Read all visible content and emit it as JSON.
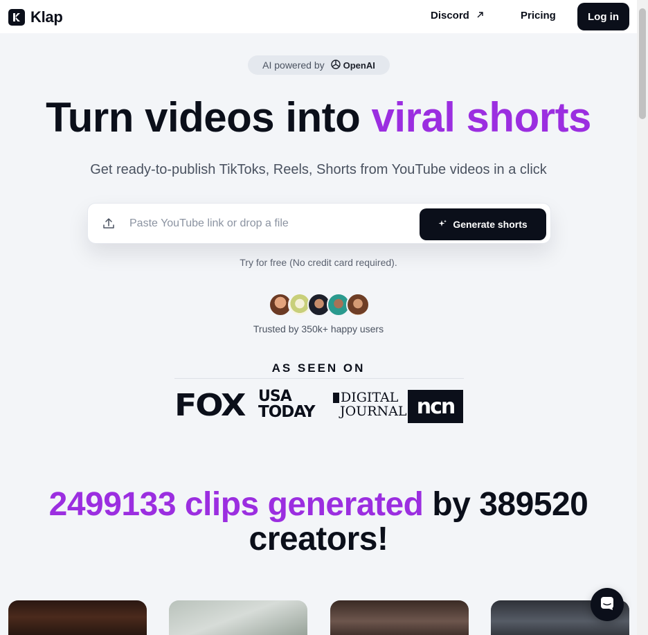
{
  "header": {
    "brand": "Klap",
    "nav": {
      "discord": "Discord",
      "pricing": "Pricing",
      "login": "Log in"
    }
  },
  "badge": {
    "prefix": "AI powered by",
    "partner": "OpenAI"
  },
  "hero": {
    "title_plain": "Turn videos into",
    "title_accent": "viral shorts",
    "subtitle": "Get ready-to-publish TikToks, Reels, Shorts from YouTube videos in a click"
  },
  "input": {
    "placeholder": "Paste YouTube link or drop a file",
    "value": "",
    "button": "Generate shorts",
    "note": "Try for free (No credit card required)."
  },
  "social_proof": {
    "avatars": [
      "avatar-1",
      "avatar-2",
      "avatar-3",
      "avatar-4",
      "avatar-5"
    ],
    "trusted": "Trusted by 350k+ happy users"
  },
  "press": {
    "title": "AS SEEN ON",
    "logos": {
      "fox": "FOX",
      "usa_line1": "USA",
      "usa_line2": "TODAY",
      "dj_line1": "DIGITAL",
      "dj_line2": "JOURNAL",
      "ncn": "ncn"
    }
  },
  "stats": {
    "clips_count": "2499133",
    "clips_label": "clips generated",
    "by": "by",
    "creators_count": "389520",
    "creators_label": "creators!"
  },
  "colors": {
    "accent": "#9b2ee0",
    "primary": "#0b0f1a",
    "background": "#f3f5f8"
  },
  "icons": [
    "klap-logo-icon",
    "external-link-icon",
    "openai-icon",
    "upload-icon",
    "sparkle-icon",
    "chat-icon"
  ]
}
